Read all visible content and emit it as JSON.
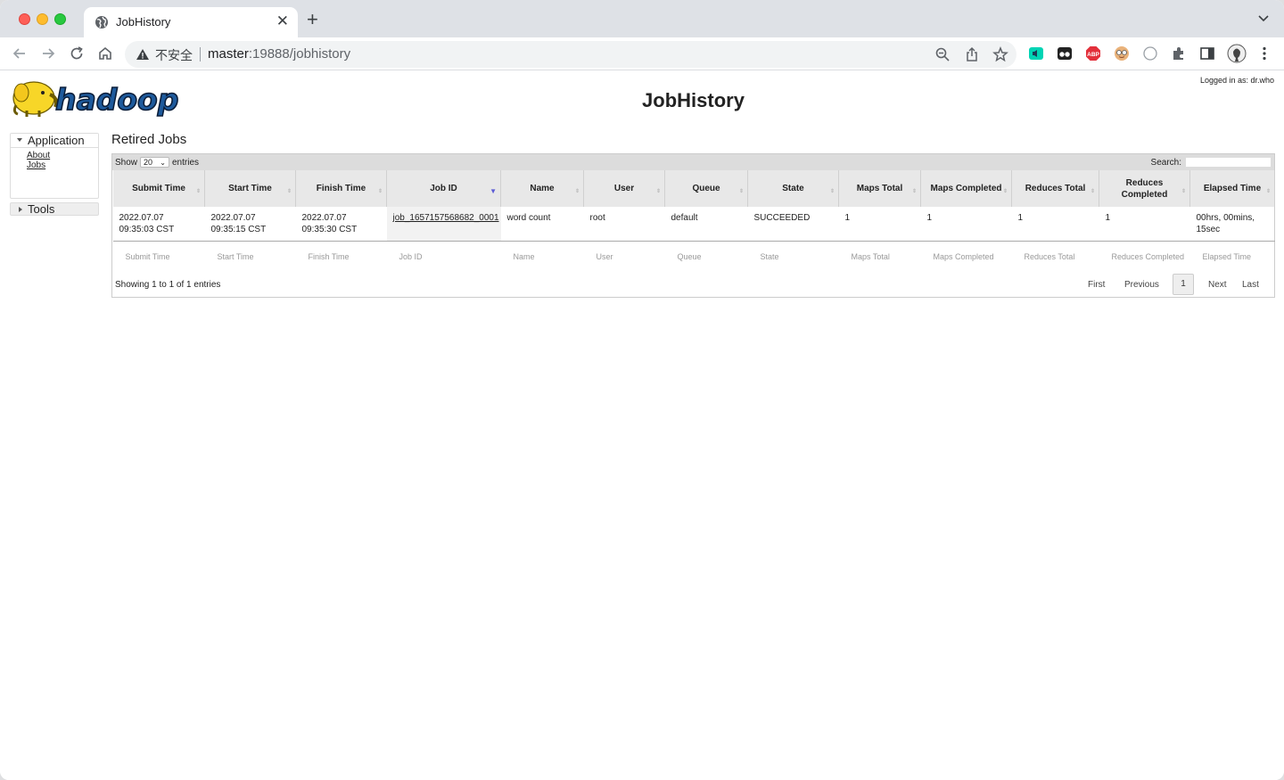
{
  "browser": {
    "tab_title": "JobHistory",
    "insecure_label": "不安全",
    "url_host": "master",
    "url_rest": ":19888/jobhistory",
    "extension_abp": "ABP"
  },
  "page": {
    "title": "JobHistory",
    "logo_text": "hadoop",
    "logged_in": "Logged in as: dr.who"
  },
  "nav": {
    "application_label": "Application",
    "links": [
      "About",
      "Jobs"
    ],
    "tools_label": "Tools"
  },
  "retired_jobs": {
    "heading": "Retired Jobs",
    "show_label": "Show",
    "page_size": "20",
    "entries_label": "entries",
    "search_label": "Search:",
    "columns": [
      "Submit Time",
      "Start Time",
      "Finish Time",
      "Job ID",
      "Name",
      "User",
      "Queue",
      "State",
      "Maps Total",
      "Maps Completed",
      "Reduces Total",
      "Reduces Completed",
      "Elapsed Time"
    ],
    "rows": [
      {
        "submit_time": "2022.07.07 09:35:03 CST",
        "start_time": "2022.07.07 09:35:15 CST",
        "finish_time": "2022.07.07 09:35:30 CST",
        "job_id": "job_1657157568682_0001",
        "name": "word count",
        "user": "root",
        "queue": "default",
        "state": "SUCCEEDED",
        "maps_total": "1",
        "maps_completed": "1",
        "reduces_total": "1",
        "reduces_completed": "1",
        "elapsed_time": "00hrs, 00mins, 15sec"
      }
    ],
    "footer_columns": [
      "Submit Time",
      "Start Time",
      "Finish Time",
      "Job ID",
      "Name",
      "User",
      "Queue",
      "State",
      "Maps Total",
      "Maps Completed",
      "Reduces Total",
      "Reduces Completed",
      "Elapsed Time"
    ],
    "info": "Showing 1 to 1 of 1 entries",
    "pager": {
      "first": "First",
      "previous": "Previous",
      "current": "1",
      "next": "Next",
      "last": "Last"
    }
  }
}
